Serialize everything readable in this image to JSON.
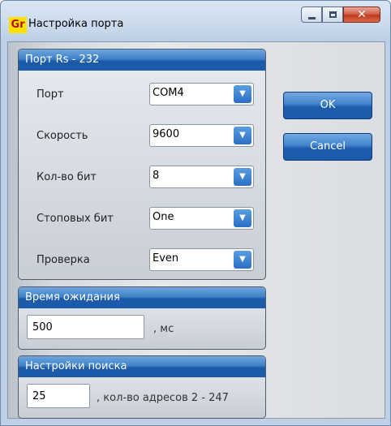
{
  "window": {
    "icon_text": "Gr",
    "title": "Настройка порта"
  },
  "port_group": {
    "header": "Порт Rs - 232",
    "fields": [
      {
        "label": "Порт",
        "value": "COM4"
      },
      {
        "label": "Скорость",
        "value": "9600"
      },
      {
        "label": "Кол-во бит",
        "value": "8"
      },
      {
        "label": "Стоповых бит",
        "value": "One"
      },
      {
        "label": "Проверка",
        "value": "Even"
      }
    ]
  },
  "timeout_group": {
    "header": "Время ожидания",
    "value": "500",
    "suffix": ", мс"
  },
  "search_group": {
    "header": "Настройки поиска",
    "value": "25",
    "suffix": ", кол-во адресов 2 - 247"
  },
  "buttons": {
    "ok": "OK",
    "cancel": "Cancel"
  },
  "icons": {
    "dropdown": "chevron-down-icon",
    "close": "close-icon",
    "minimize": "minimize-icon",
    "maximize": "maximize-icon"
  },
  "colors": {
    "accent": "#1e5cac",
    "close_button": "#c13a20",
    "app_icon_bg": "#ffe100"
  }
}
